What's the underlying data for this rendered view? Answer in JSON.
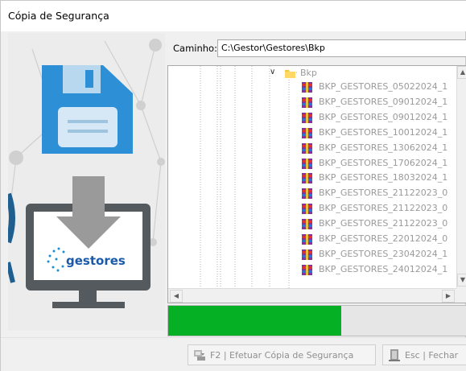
{
  "window": {
    "title": "Cópia de Segurança"
  },
  "path": {
    "label": "Caminho:",
    "value": "C:\\Gestor\\Gestores\\Bkp"
  },
  "logo": {
    "text": "gestores"
  },
  "tree": {
    "root": "Bkp",
    "items": [
      "BKP_GESTORES_05022024_1",
      "BKP_GESTORES_09012024_1",
      "BKP_GESTORES_09012024_1",
      "BKP_GESTORES_10012024_1",
      "BKP_GESTORES_13062024_1",
      "BKP_GESTORES_17062024_1",
      "BKP_GESTORES_18032024_1",
      "BKP_GESTORES_21122023_0",
      "BKP_GESTORES_21122023_0",
      "BKP_GESTORES_21122023_0",
      "BKP_GESTORES_22012024_0",
      "BKP_GESTORES_23042024_1",
      "BKP_GESTORES_24012024_1"
    ]
  },
  "progress": {
    "fraction": 0.58,
    "color": "#06b025"
  },
  "buttons": {
    "backup_label": "F2 | Efetuar Cópia de Segurança",
    "close_label": "Esc | Fechar"
  },
  "colors": {
    "floppy": "#2d8fd6",
    "monitor": "#555a5e",
    "logo_blue": "#1a5aa8"
  }
}
